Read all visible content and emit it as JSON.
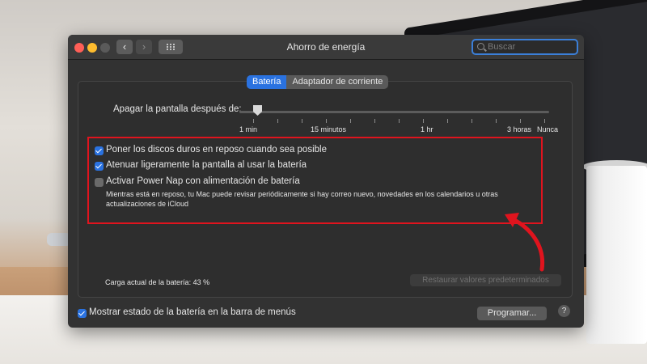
{
  "window": {
    "title": "Ahorro de energía"
  },
  "search": {
    "placeholder": "Buscar"
  },
  "tabs": [
    {
      "label": "Batería",
      "active": true
    },
    {
      "label": "Adaptador de corriente",
      "active": false
    }
  ],
  "slider": {
    "label": "Apagar la pantalla después de:",
    "ticks": [
      "1 min",
      "15 minutos",
      "1 hr",
      "3 horas",
      "Nunca"
    ],
    "value": "1 min"
  },
  "options": [
    {
      "label": "Poner los discos duros en reposo cuando sea posible",
      "checked": true
    },
    {
      "label": "Atenuar ligeramente la pantalla al usar la batería",
      "checked": true
    },
    {
      "label": "Activar Power Nap con alimentación de batería",
      "checked": false
    }
  ],
  "power_nap_description": "Mientras está en reposo, tu Mac puede revisar periódicamente si hay correo nuevo, novedades en los calendarios u otras actualizaciones de iCloud",
  "battery_charge": "Carga actual de la batería: 43 %",
  "restore_button": "Restaurar valores predeterminados",
  "show_status": {
    "label": "Mostrar estado de la batería en la barra de menús",
    "checked": true
  },
  "schedule_button": "Programar...",
  "help_button": "?",
  "colors": {
    "accent": "#2a72e0",
    "annotation": "#e0141e",
    "window_bg": "#323232"
  }
}
